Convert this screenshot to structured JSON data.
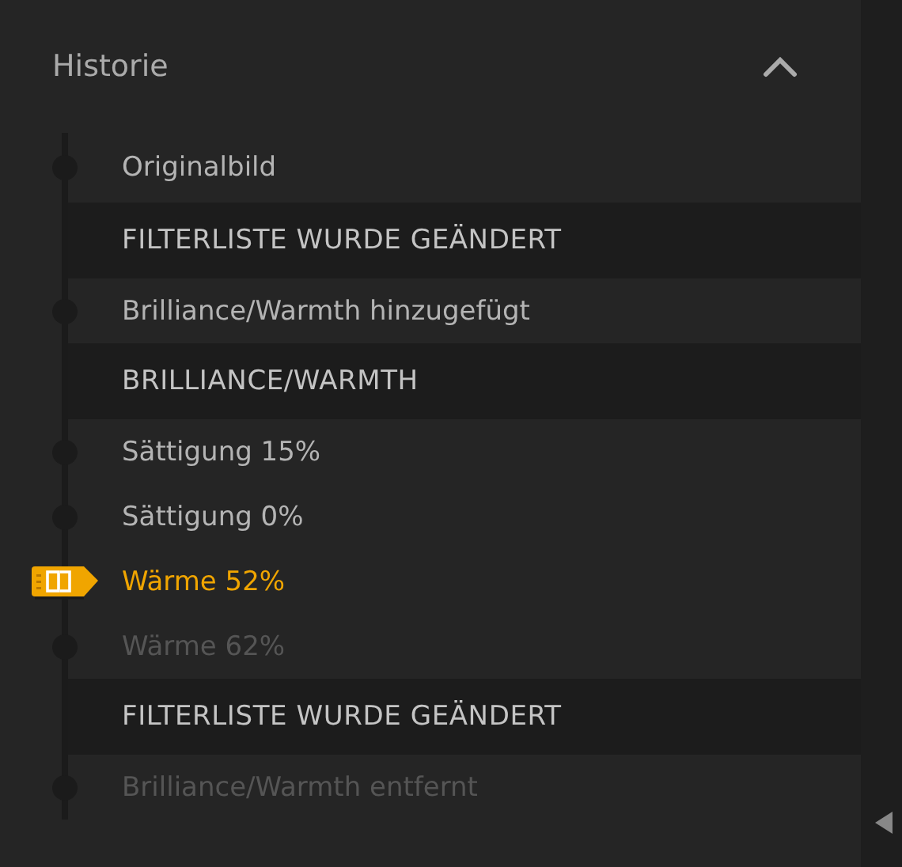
{
  "panel": {
    "title": "Historie",
    "expanded": true
  },
  "history": [
    {
      "kind": "step",
      "label": "Originalbild",
      "current": false,
      "undone": false
    },
    {
      "kind": "group",
      "label": "FILTERLISTE WURDE GEÄNDERT"
    },
    {
      "kind": "step",
      "label": "Brilliance/Warmth hinzugefügt",
      "current": false,
      "undone": false
    },
    {
      "kind": "group",
      "label": "BRILLIANCE/WARMTH"
    },
    {
      "kind": "step",
      "label": "Sättigung 15%",
      "current": false,
      "undone": false
    },
    {
      "kind": "step",
      "label": "Sättigung 0%",
      "current": false,
      "undone": false
    },
    {
      "kind": "step",
      "label": "Wärme 52%",
      "current": true,
      "undone": false
    },
    {
      "kind": "step",
      "label": "Wärme 62%",
      "current": false,
      "undone": true
    },
    {
      "kind": "group",
      "label": "FILTERLISTE WURDE GEÄNDERT"
    },
    {
      "kind": "step",
      "label": "Brilliance/Warmth entfernt",
      "current": false,
      "undone": true
    }
  ]
}
